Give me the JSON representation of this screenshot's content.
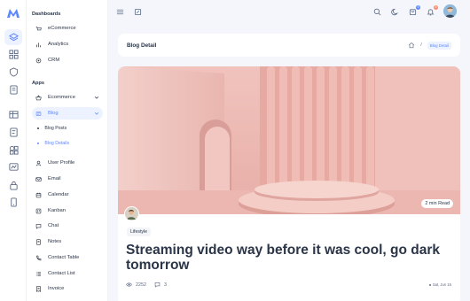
{
  "rail_icons": [
    "logo-icon",
    "layers-icon",
    "layout-icon",
    "shield-icon",
    "pages-icon",
    "table-icon",
    "forms-icon",
    "widgets-icon",
    "chart-icon",
    "lock-icon",
    "mobile-icon"
  ],
  "sidebar": {
    "dashboards_label": "Dashboards",
    "dashboards": [
      {
        "label": "eCommerce",
        "icon": "ecommerce-icon"
      },
      {
        "label": "Analytics",
        "icon": "analytics-icon"
      },
      {
        "label": "CRM",
        "icon": "crm-icon"
      }
    ],
    "apps_label": "Apps",
    "apps": [
      {
        "label": "Ecommerce",
        "icon": "basket-icon"
      },
      {
        "label": "Blog",
        "icon": "blog-icon",
        "active": true
      },
      {
        "label": "Blog Posts",
        "sub": true
      },
      {
        "label": "Blog Details",
        "sub": true,
        "current": true
      },
      {
        "label": "User Profile",
        "icon": "user-icon"
      },
      {
        "label": "Email",
        "icon": "mail-icon"
      },
      {
        "label": "Calendar",
        "icon": "calendar-icon"
      },
      {
        "label": "Kanban",
        "icon": "kanban-icon"
      },
      {
        "label": "Chat",
        "icon": "chat-icon"
      },
      {
        "label": "Notes",
        "icon": "notes-icon"
      },
      {
        "label": "Contact Table",
        "icon": "phone-icon"
      },
      {
        "label": "Contact List",
        "icon": "list-icon"
      },
      {
        "label": "Invoice",
        "icon": "invoice-icon"
      }
    ]
  },
  "topbar": {
    "cart_count": "5",
    "notification_count": "8"
  },
  "header": {
    "title": "Blog Detail",
    "separator": "/",
    "breadcrumb_current": "Blog Detail"
  },
  "post": {
    "read_time": "2 min Read",
    "tag": "Lifestyle",
    "title": "Streaming video way before it was cool, go dark tomorrow",
    "views": "2252",
    "comments": "3",
    "date": "Sat, Jun 15"
  },
  "colors": {
    "accent": "#5d87ff",
    "accent_soft": "#ecf2ff",
    "text": "#2a3547",
    "hero_pink": "#e9b3ad"
  }
}
